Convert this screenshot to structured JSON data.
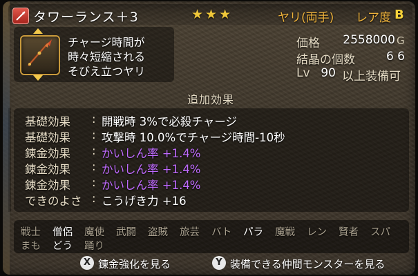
{
  "header": {
    "item_name": "タワーランス＋3",
    "stars": "★★★",
    "weapon_type": "ヤリ(両手)",
    "rarity_label": "レア度",
    "rarity_grade": "B"
  },
  "item": {
    "desc_lines": [
      "チャージ時間が",
      "時々短縮される",
      "そびえ立つヤリ"
    ]
  },
  "stats": {
    "price_label": "価格",
    "price_value": "2558000",
    "price_unit": "G",
    "crystal_label": "結晶の個数",
    "crystal_value": "6 6",
    "lv_label": "Lv",
    "lv_value": "90",
    "lv_suffix": "以上装備可"
  },
  "effects": {
    "title": "追加効果",
    "rows": [
      {
        "label": "基礎効果",
        "value": "開戦時 3%で必殺チャージ",
        "color": "#ffffff"
      },
      {
        "label": "基礎効果",
        "value": "攻撃時 10.0%でチャージ時間-10秒",
        "color": "#ffffff"
      },
      {
        "label": "錬金効果",
        "value": "かいしん率 +1.4%",
        "color": "#c06bff"
      },
      {
        "label": "錬金効果",
        "value": "かいしん率 +1.4%",
        "color": "#c06bff"
      },
      {
        "label": "錬金効果",
        "value": "かいしん率 +1.4%",
        "color": "#c06bff"
      },
      {
        "label": "できのよさ",
        "value": "こうげき力 +16",
        "color": "#ffffff"
      }
    ]
  },
  "jobs": [
    {
      "name": "戦士",
      "enabled": false
    },
    {
      "name": "僧侶",
      "enabled": true
    },
    {
      "name": "魔使",
      "enabled": false
    },
    {
      "name": "武闘",
      "enabled": false
    },
    {
      "name": "盗賊",
      "enabled": false
    },
    {
      "name": "旅芸",
      "enabled": false
    },
    {
      "name": "バト",
      "enabled": false
    },
    {
      "name": "パラ",
      "enabled": true
    },
    {
      "name": "魔戦",
      "enabled": false
    },
    {
      "name": "レン",
      "enabled": false
    },
    {
      "name": "賢者",
      "enabled": false
    },
    {
      "name": "スパ",
      "enabled": false
    },
    {
      "name": "まも",
      "enabled": false
    },
    {
      "name": "どう",
      "enabled": true
    },
    {
      "name": "踊り",
      "enabled": false
    }
  ],
  "footer": {
    "x_button": "X",
    "x_label": "錬金強化を見る",
    "y_button": "Y",
    "y_label": "装備できる仲間モンスターを見る"
  },
  "colors": {
    "accent_gold": "#f0b43c",
    "alchemy_purple": "#c06bff"
  },
  "icons": {
    "category": "spear-category-icon",
    "item": "spear-item-icon"
  }
}
